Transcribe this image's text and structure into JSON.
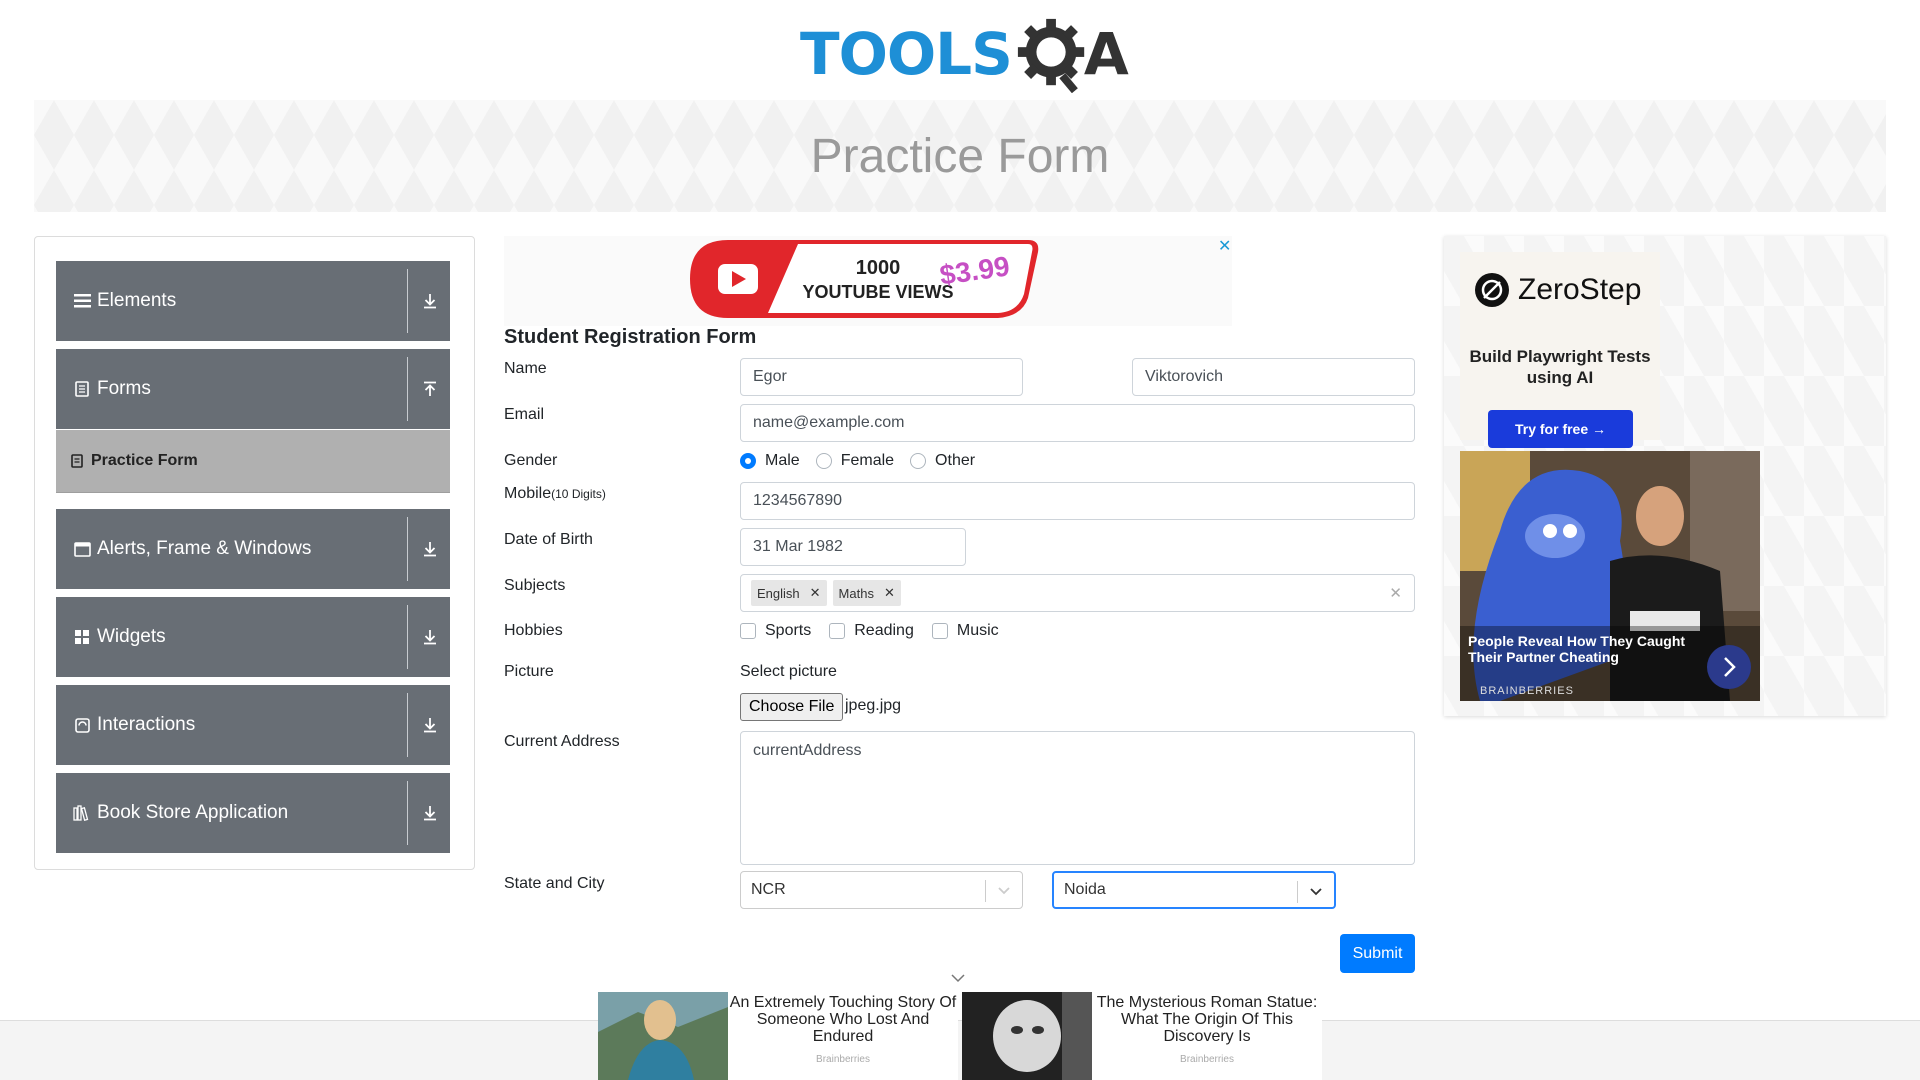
{
  "header": {
    "logo_text_left": "TOOLS",
    "logo_text_right": "A"
  },
  "banner": {
    "title": "Practice Form"
  },
  "sidebar": {
    "groups": [
      {
        "label": "Elements",
        "icon": "list-icon",
        "toggle": "download-icon"
      },
      {
        "label": "Forms",
        "icon": "form-icon",
        "toggle": "upload-icon"
      },
      {
        "label": "Alerts, Frame & Windows",
        "icon": "window-icon",
        "toggle": "download-icon"
      },
      {
        "label": "Widgets",
        "icon": "widgets-icon",
        "toggle": "download-icon"
      },
      {
        "label": "Interactions",
        "icon": "interactions-icon",
        "toggle": "download-icon"
      },
      {
        "label": "Book Store Application",
        "icon": "books-icon",
        "toggle": "download-icon"
      }
    ],
    "active_item": "Practice Form"
  },
  "ad_top": {
    "text_line1": "1000",
    "text_line2": "YOUTUBE VIEWS",
    "price": "$3.99",
    "close": "✕"
  },
  "form": {
    "title": "Student Registration Form",
    "labels": {
      "name": "Name",
      "email": "Email",
      "gender": "Gender",
      "mobile": "Mobile",
      "mobile_hint": "(10 Digits)",
      "dob": "Date of Birth",
      "subjects": "Subjects",
      "hobbies": "Hobbies",
      "picture": "Picture",
      "address": "Current Address",
      "state_city": "State and City"
    },
    "first_name": "Egor",
    "last_name": "Viktorovich",
    "email_placeholder": "name@example.com",
    "genders": [
      "Male",
      "Female",
      "Other"
    ],
    "gender_selected": "Male",
    "mobile": "1234567890",
    "dob": "31 Mar 1982",
    "subjects": [
      "English",
      "Maths"
    ],
    "hobbies": [
      "Sports",
      "Reading",
      "Music"
    ],
    "picture_label": "Select picture",
    "choose_file": "Choose File",
    "file_name": "jpeg.jpg",
    "address_placeholder": "currentAddress",
    "state": "NCR",
    "city": "Noida",
    "submit": "Submit"
  },
  "ad_right": {
    "brand": "ZeroStep",
    "tagline": "Build Playwright Tests using AI",
    "cta": "Try for free →",
    "photo_caption": "People Reveal How They Caught Their Partner Cheating",
    "photo_source": "BRAINBERRIES"
  },
  "bottom_ads": [
    {
      "text": "An Extremely Touching Story Of Someone Who Lost And Endured",
      "source": "Brainberries"
    },
    {
      "text": "The Mysterious Roman Statue: What The Origin Of This Discovery Is",
      "source": "Brainberries"
    }
  ],
  "colors": {
    "accent": "#007bff",
    "sidebar": "#686e75",
    "logo_blue": "#1e8fd6"
  }
}
